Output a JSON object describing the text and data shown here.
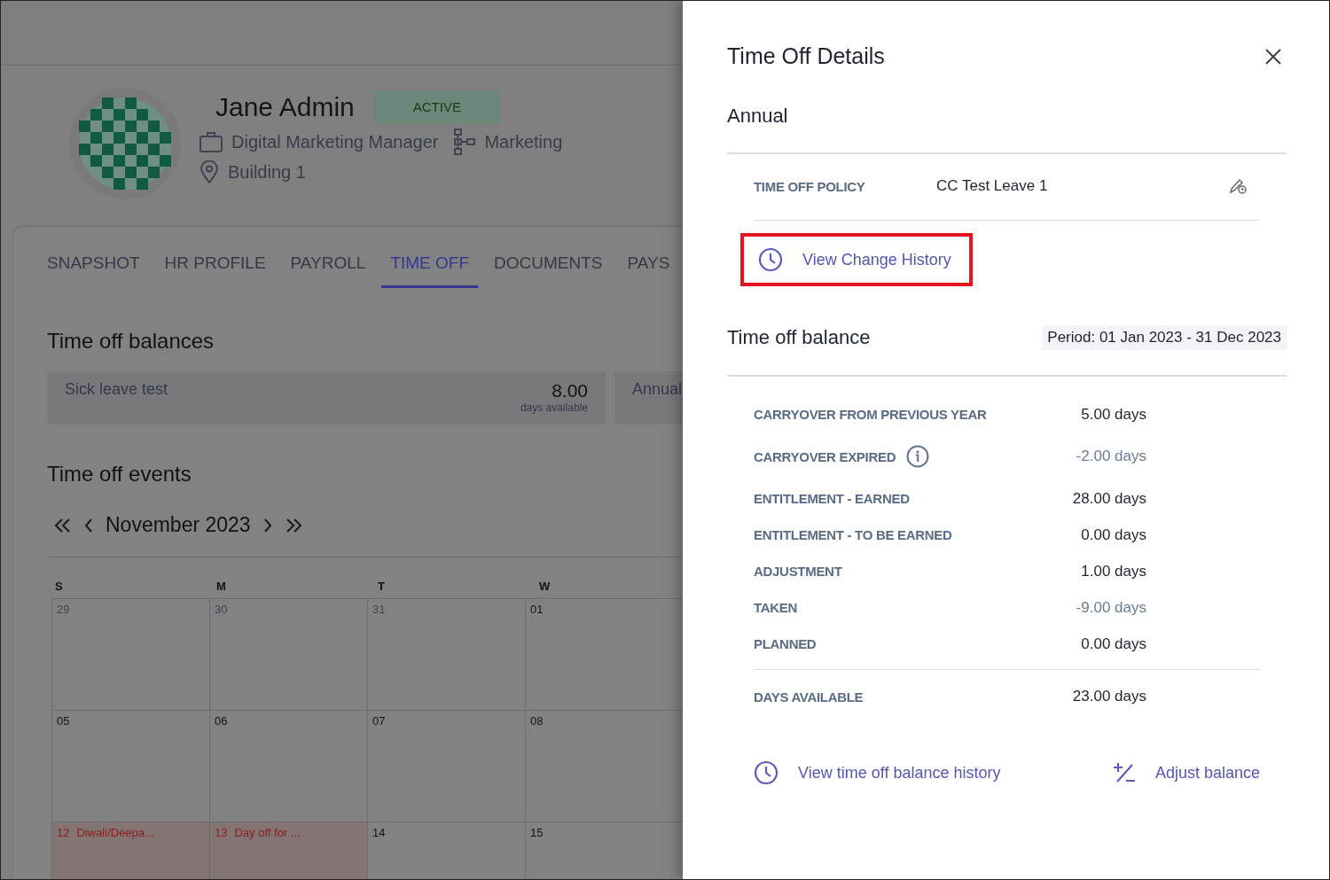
{
  "profile": {
    "name": "Jane Admin",
    "status": "ACTIVE",
    "job_title": "Digital Marketing Manager",
    "department": "Marketing",
    "location": "Building 1"
  },
  "tabs": [
    {
      "label": "SNAPSHOT",
      "selected": false
    },
    {
      "label": "HR PROFILE",
      "selected": false
    },
    {
      "label": "PAYROLL",
      "selected": false
    },
    {
      "label": "TIME OFF",
      "selected": true
    },
    {
      "label": "DOCUMENTS",
      "selected": false
    },
    {
      "label": "PAYS",
      "selected": false
    }
  ],
  "balances": {
    "title": "Time off balances",
    "cards": [
      {
        "name": "Sick leave test",
        "amount": "8.00",
        "unit": "days available"
      },
      {
        "name": "Annual"
      }
    ]
  },
  "events": {
    "title": "Time off events",
    "month": "November 2023",
    "weekdays": [
      "S",
      "M",
      "T",
      "W"
    ],
    "weeks": [
      [
        {
          "day": "29",
          "outside_month": true,
          "holiday": false
        },
        {
          "day": "30",
          "outside_month": true,
          "holiday": false
        },
        {
          "day": "31",
          "outside_month": true,
          "holiday": false
        },
        {
          "day": "01",
          "outside_month": false,
          "holiday": false
        }
      ],
      [
        {
          "day": "05",
          "outside_month": false,
          "holiday": false
        },
        {
          "day": "06",
          "outside_month": false,
          "holiday": false
        },
        {
          "day": "07",
          "outside_month": false,
          "holiday": false
        },
        {
          "day": "08",
          "outside_month": false,
          "holiday": false
        }
      ],
      [
        {
          "day": "12",
          "event": "Diwali/Deepa...",
          "outside_month": false,
          "holiday": true
        },
        {
          "day": "13",
          "event": "Day off for ...",
          "outside_month": false,
          "holiday": true
        },
        {
          "day": "14",
          "outside_month": false,
          "holiday": false
        },
        {
          "day": "15",
          "outside_month": false,
          "holiday": false
        }
      ]
    ]
  },
  "drawer": {
    "title": "Time Off Details",
    "subtitle": "Annual",
    "policy": {
      "label": "TIME OFF POLICY",
      "value": "CC Test Leave 1"
    },
    "change_history_link": {
      "label": "View Change History",
      "highlighted": true
    },
    "balance": {
      "title": "Time off balance",
      "period": "Period: 01 Jan 2023 - 31 Dec 2023",
      "rows": [
        {
          "label": "CARRYOVER FROM PREVIOUS YEAR",
          "value": "5.00 days",
          "muted": false,
          "info": false
        },
        {
          "label": "CARRYOVER EXPIRED",
          "value": "-2.00 days",
          "muted": true,
          "info": true
        },
        {
          "label": "ENTITLEMENT - EARNED",
          "value": "28.00 days",
          "muted": false,
          "info": false
        },
        {
          "label": "ENTITLEMENT - TO BE EARNED",
          "value": "0.00 days",
          "muted": false,
          "info": false
        },
        {
          "label": "ADJUSTMENT",
          "value": "1.00 days",
          "muted": false,
          "info": false
        },
        {
          "label": "TAKEN",
          "value": "-9.00 days",
          "muted": true,
          "info": false
        },
        {
          "label": "PLANNED",
          "value": "0.00 days",
          "muted": false,
          "info": false
        }
      ],
      "total": {
        "label": "DAYS AVAILABLE",
        "value": "23.00 days"
      }
    },
    "history_link": "View time off balance history",
    "adjust_link": "Adjust balance"
  }
}
